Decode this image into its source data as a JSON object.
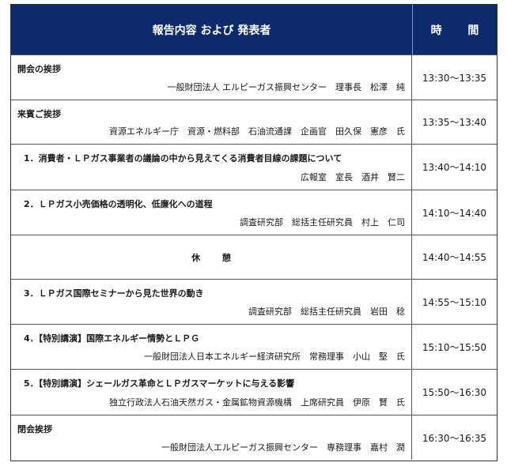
{
  "header": {
    "title": "報告内容 および 発表者",
    "time_label": "時 間"
  },
  "rows": [
    {
      "title": "開会の挨拶",
      "speaker": "一般財団法人 エルピーガス振興センター　理事長　松澤　純",
      "time": "13:30～13:35"
    },
    {
      "title": "来賓ご挨拶",
      "speaker": "資源エネルギー庁　資源・燃料部　石油流通課　企画官　田久保　憲彦　氏",
      "time": "13:35～13:40"
    },
    {
      "title": "1．消費者・ＬＰガス事業者の議論の中から見えてくる消費者目線の課題について",
      "speaker": "広報室　室長　酒井　賢二",
      "time": "13:40～14:10"
    },
    {
      "title": "2．ＬＰガス小売価格の透明化、低廉化への道程",
      "speaker": "調査研究部　総括主任研究員　村上　仁司",
      "time": "14:10～14:40"
    },
    {
      "title": "休 憩",
      "speaker": "",
      "time": "14:40～14:55"
    },
    {
      "title": "3．ＬＰガス国際セミナーから見た世界の動き",
      "speaker": "調査研究部　総括主任研究員　岩田　稔",
      "time": "14:55～15:10"
    },
    {
      "title": "4．【特別講演】国際エネルギー情勢とＬＰＧ",
      "speaker": "一般財団法人日本エネルギー経済研究所　常務理事　小山　堅　氏",
      "time": "15:10～15:50"
    },
    {
      "title": "5．【特別講演】シェールガス革命とＬＰガスマーケットに与える影響",
      "speaker": "独立行政法人石油天然ガス・金属鉱物資源機構　上席研究員　伊原　賢　氏",
      "time": "15:50～16:30"
    },
    {
      "title": "閉会挨拶",
      "speaker": "一般財団法人エルピーガス振興センター　専務理事　嘉村　潤",
      "time": "16:30～16:35"
    }
  ]
}
